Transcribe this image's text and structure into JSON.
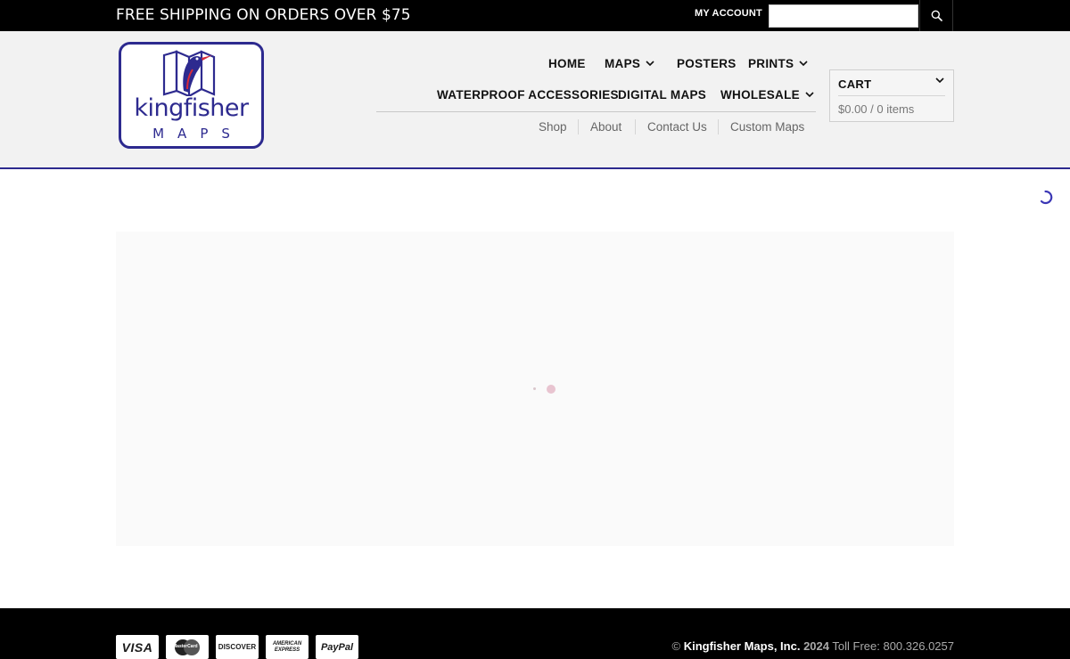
{
  "topbar": {
    "promo": "FREE SHIPPING ON ORDERS OVER $75",
    "my_account": "MY ACCOUNT",
    "search_value": "",
    "search_placeholder": ""
  },
  "logo": {
    "word": "kingfisher",
    "sub": "MAPS"
  },
  "nav": {
    "primary": [
      {
        "label": "HOME",
        "dropdown": false
      },
      {
        "label": "MAPS",
        "dropdown": true
      },
      {
        "label": "POSTERS",
        "dropdown": false
      },
      {
        "label": "PRINTS",
        "dropdown": true
      },
      {
        "label": "WATERPROOF ACCESSORIES",
        "dropdown": false
      },
      {
        "label": "DIGITAL MAPS",
        "dropdown": false
      },
      {
        "label": "WHOLESALE",
        "dropdown": true
      }
    ],
    "secondary": [
      "Shop",
      "About",
      "Contact Us",
      "Custom Maps"
    ]
  },
  "cart": {
    "title": "CART",
    "total": "$0.00 / 0 items"
  },
  "footer": {
    "payments": [
      "VISA",
      "MasterCard",
      "DISCOVER",
      "AMERICAN EXPRESS",
      "PayPal"
    ],
    "copyright_symbol": "©",
    "company": "Kingfisher Maps, Inc.",
    "year": "2024",
    "toll_free": "Toll Free: 800.326.0257"
  },
  "colors": {
    "brand_blue": "#2d2a8f",
    "accent_red": "#d62b3a",
    "topbar_bg": "#000000",
    "header_bg": "#f2f2f2"
  }
}
